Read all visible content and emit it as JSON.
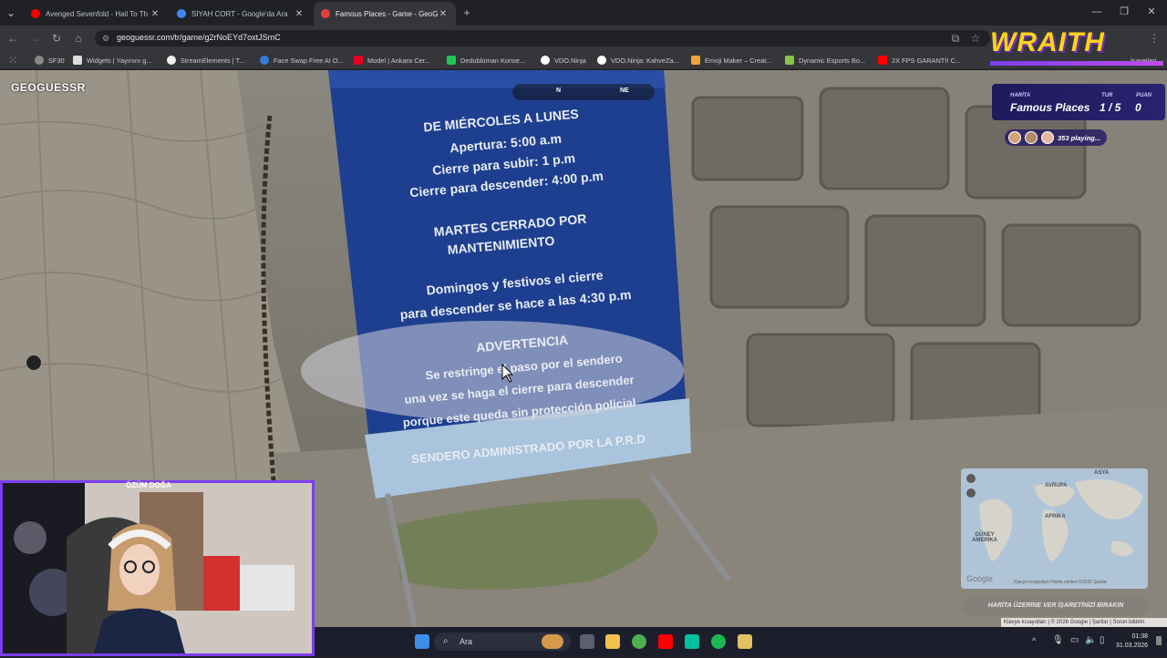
{
  "browser": {
    "tabs": [
      {
        "title": "Avenged Sevenfold - Hail To Th",
        "favicon_color": "#ff0000",
        "active": false
      },
      {
        "title": "SİYAH CORT - Google'da Ara",
        "favicon_color": "#4285f4",
        "active": false
      },
      {
        "title": "Famous Places - Game - GeoG",
        "favicon_color": "#e23f3f",
        "active": true
      }
    ],
    "new_tab_icon": "plus-icon",
    "url": "geoguessr.com/tr/game/g2rNoEYd7oxtJSmC",
    "bookmarks": [
      "SF30",
      "Widgets | Yayınını g...",
      "StreamElements | T...",
      "Face Swap Free AI O...",
      "Model | Ankara Cer...",
      "Dedublüman Konse...",
      "VDO.Ninja",
      "VDO.Ninja: KahveZa...",
      "Emoji Maker – Creat...",
      "Dynamic Esports Bo...",
      "2X FPS GARANTİ! C..."
    ],
    "bookmark_extra": "İşaretleri"
  },
  "game": {
    "logo": "GEOGUESSR",
    "compass": {
      "n": "N",
      "ne": "NE"
    },
    "hud": {
      "map_label": "HARİTA",
      "map_value": "Famous Places",
      "round_label": "TUR",
      "round_value": "1 / 5",
      "score_label": "PUAN",
      "score_value": "0"
    },
    "players_playing": "353 playing...",
    "guess_button": "HARİTA ÜZERİNE VER İŞARETİNİZİ BIRAKIN",
    "map_labels": {
      "asia": "ASYA",
      "europe": "AVRUPA",
      "africa": "AFRİKA",
      "south_america": "GÜNEY AMERİKA"
    },
    "map_attribution": "Google",
    "footer": "Klavye kısayolları | © 2026 Google | Şartlar | Sorun bildirin",
    "minimap_footer": "Klavye kısayolları   Harita verileri ©2026   Şartlar"
  },
  "sign": {
    "header": "SENDERO",
    "line1": "DE MIÉRCOLES A LUNES",
    "line2": "Apertura:  5:00 a.m",
    "line3": "Cierre para subir: 1 p.m",
    "line4": "Cierre para descender: 4:00 p.m",
    "line5": "MARTES CERRADO POR",
    "line6": "MANTENIMIENTO",
    "line7": "Domingos y festivos  el cierre",
    "line8": "para descender se hace a  las 4:30 p.m",
    "line9": "ADVERTENCIA",
    "line10": "Se restringe el paso por el sendero",
    "line11": "una vez se haga el cierre para descender",
    "line12": "porque este queda sin protección policial",
    "line13": "SENDERO ADMINISTRADO POR LA P.R.D"
  },
  "overlay": {
    "brand": "WRAITH",
    "streamer_name": "ÖZÜM DOĞA"
  },
  "taskbar": {
    "search_placeholder": "Ara",
    "time": "01:38",
    "date": "31.03.2026"
  }
}
